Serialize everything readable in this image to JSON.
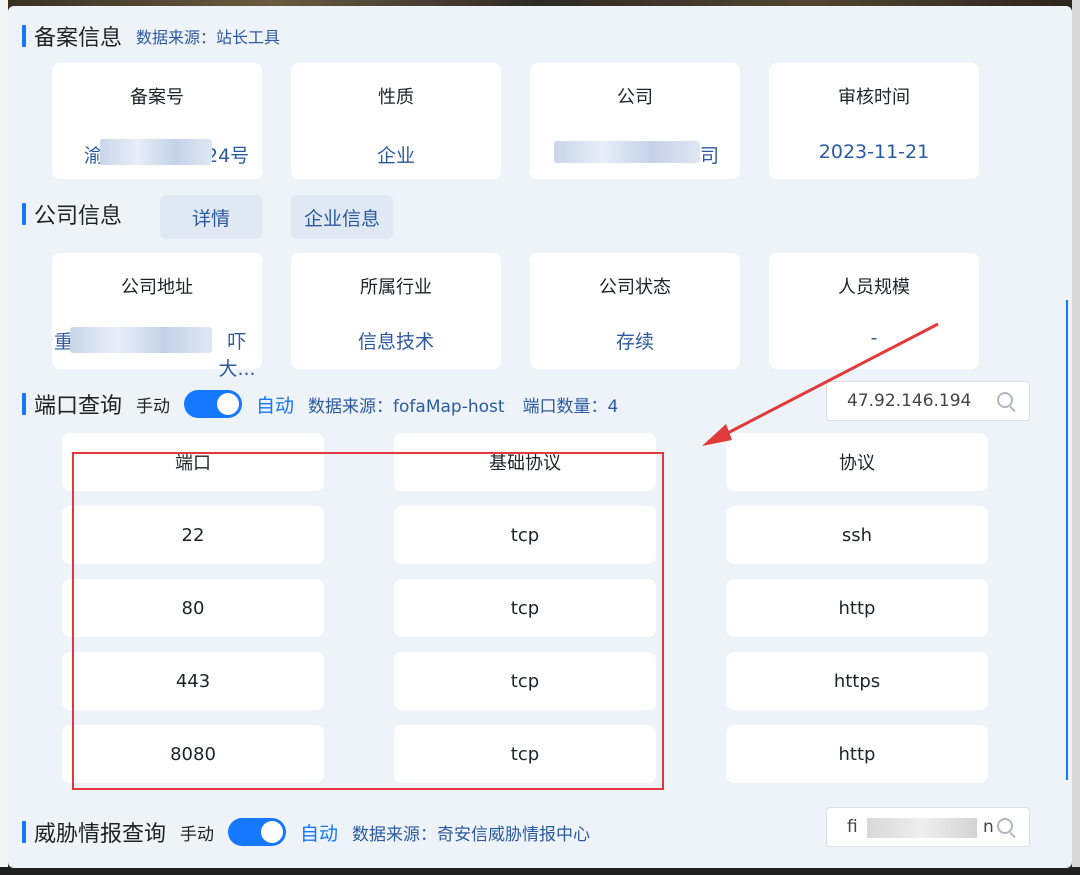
{
  "beian": {
    "title": "备案信息",
    "source": "数据来源：站长工具",
    "cards": [
      {
        "label": "备案号",
        "value_prefix": "渝",
        "value_suffix": "24号"
      },
      {
        "label": "性质",
        "value": "企业"
      },
      {
        "label": "公司",
        "value_prefix": "",
        "value_suffix": "司"
      },
      {
        "label": "审核时间",
        "value": "2023-11-21"
      }
    ]
  },
  "company": {
    "title": "公司信息",
    "detail_button": "详情",
    "enterprise_button": "企业信息",
    "cards": [
      {
        "label": "公司地址",
        "value_prefix": "重",
        "value_suffix": "吓大..."
      },
      {
        "label": "所属行业",
        "value": "信息技术"
      },
      {
        "label": "公司状态",
        "value": "存续"
      },
      {
        "label": "人员规模",
        "value": "-"
      }
    ]
  },
  "port": {
    "title": "端口查询",
    "manual": "手动",
    "auto": "自动",
    "source": "数据来源：fofaMap-host",
    "count": "端口数量：4",
    "search_value": "47.92.146.194",
    "headers": [
      "端口",
      "基础协议",
      "协议"
    ],
    "rows": [
      [
        "22",
        "tcp",
        "ssh"
      ],
      [
        "80",
        "tcp",
        "http"
      ],
      [
        "443",
        "tcp",
        "https"
      ],
      [
        "8080",
        "tcp",
        "http"
      ]
    ]
  },
  "threat": {
    "title": "威胁情报查询",
    "manual": "手动",
    "auto": "自动",
    "source": "数据来源：奇安信威胁情报中心",
    "search_prefix": "fi",
    "search_suffix": "n"
  },
  "colors": {
    "accent": "#1677ff",
    "annotation": "#e03a3a"
  },
  "icons": [
    "search-icon",
    "toggle-switch",
    "annotation-arrow"
  ]
}
